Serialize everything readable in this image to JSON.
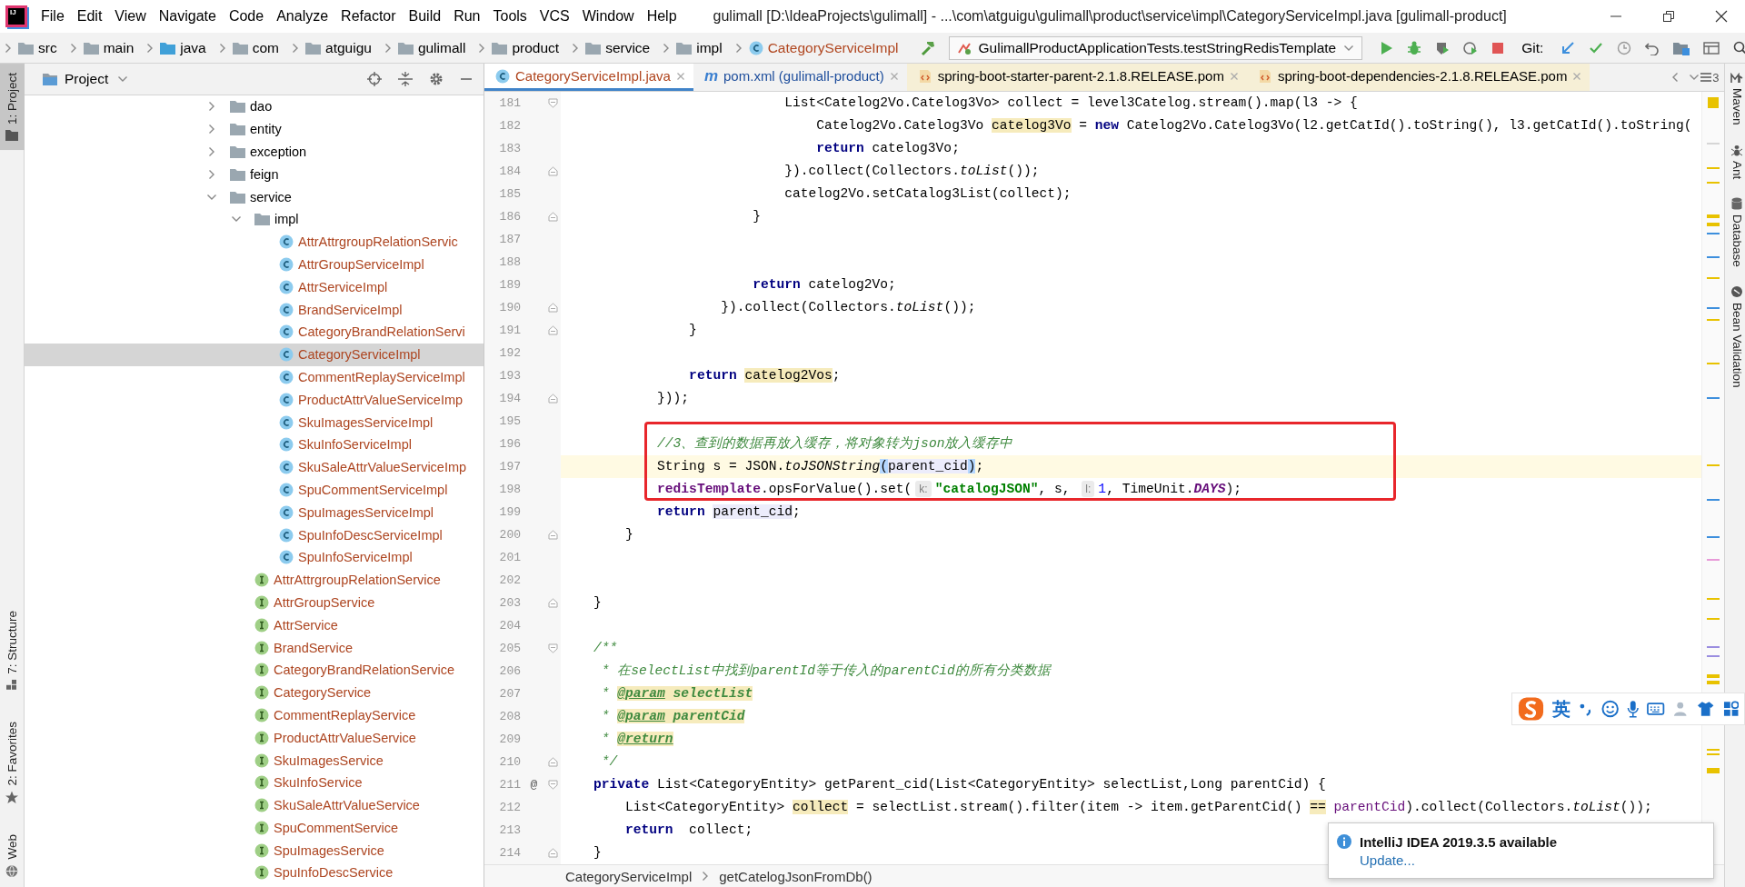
{
  "title_bar": {
    "logo_text": "IJ",
    "menus": [
      "File",
      "Edit",
      "View",
      "Navigate",
      "Code",
      "Analyze",
      "Refactor",
      "Build",
      "Run",
      "Tools",
      "VCS",
      "Window",
      "Help"
    ],
    "title": "gulimall [D:\\IdeaProjects\\gulimall] - ...\\com\\atguigu\\gulimall\\product\\service\\impl\\CategoryServiceImpl.java [gulimall-product]"
  },
  "navigation_bar": {
    "breadcrumbs": [
      {
        "label": "src",
        "kind": "folder"
      },
      {
        "label": "main",
        "kind": "folder"
      },
      {
        "label": "java",
        "kind": "source"
      },
      {
        "label": "com",
        "kind": "folder"
      },
      {
        "label": "atguigu",
        "kind": "folder"
      },
      {
        "label": "gulimall",
        "kind": "folder"
      },
      {
        "label": "product",
        "kind": "folder"
      },
      {
        "label": "service",
        "kind": "folder"
      },
      {
        "label": "impl",
        "kind": "folder"
      },
      {
        "label": "CategoryServiceImpl",
        "kind": "class"
      }
    ],
    "run_configuration": "GulimallProductApplicationTests.testStringRedisTemplate",
    "vcs_label": "Git:"
  },
  "left_tool_strip": [
    {
      "label": "1: Project",
      "kind": "project",
      "selected": true
    },
    {
      "label": "7: Structure",
      "kind": "structure",
      "selected": false
    },
    {
      "label": "2: Favorites",
      "kind": "favorites",
      "selected": false
    },
    {
      "label": "Web",
      "kind": "web",
      "selected": false
    }
  ],
  "project_panel": {
    "title": "Project",
    "tree": [
      {
        "label": "dao",
        "kind": "folder",
        "expanded": false,
        "selected": false
      },
      {
        "label": "entity",
        "kind": "folder",
        "expanded": false,
        "selected": false
      },
      {
        "label": "exception",
        "kind": "folder",
        "expanded": false,
        "selected": false
      },
      {
        "label": "feign",
        "kind": "folder",
        "expanded": false,
        "selected": false
      },
      {
        "label": "service",
        "kind": "folder",
        "expanded": true,
        "selected": false,
        "children": [
          {
            "label": "impl",
            "kind": "folder",
            "expanded": true,
            "selected": false,
            "children": [
              {
                "label": "AttrAttrgroupRelationServic",
                "kind": "class",
                "selected": false
              },
              {
                "label": "AttrGroupServiceImpl",
                "kind": "class",
                "selected": false
              },
              {
                "label": "AttrServiceImpl",
                "kind": "class",
                "selected": false
              },
              {
                "label": "BrandServiceImpl",
                "kind": "class",
                "selected": false
              },
              {
                "label": "CategoryBrandRelationServi",
                "kind": "class",
                "selected": false
              },
              {
                "label": "CategoryServiceImpl",
                "kind": "class",
                "selected": true
              },
              {
                "label": "CommentReplayServiceImpl",
                "kind": "class",
                "selected": false
              },
              {
                "label": "ProductAttrValueServiceImp",
                "kind": "class",
                "selected": false
              },
              {
                "label": "SkuImagesServiceImpl",
                "kind": "class",
                "selected": false
              },
              {
                "label": "SkuInfoServiceImpl",
                "kind": "class",
                "selected": false
              },
              {
                "label": "SkuSaleAttrValueServiceImp",
                "kind": "class",
                "selected": false
              },
              {
                "label": "SpuCommentServiceImpl",
                "kind": "class",
                "selected": false
              },
              {
                "label": "SpuImagesServiceImpl",
                "kind": "class",
                "selected": false
              },
              {
                "label": "SpuInfoDescServiceImpl",
                "kind": "class",
                "selected": false
              },
              {
                "label": "SpuInfoServiceImpl",
                "kind": "class",
                "selected": false
              }
            ]
          },
          {
            "label": "AttrAttrgroupRelationService",
            "kind": "interface",
            "selected": false
          },
          {
            "label": "AttrGroupService",
            "kind": "interface",
            "selected": false
          },
          {
            "label": "AttrService",
            "kind": "interface",
            "selected": false
          },
          {
            "label": "BrandService",
            "kind": "interface",
            "selected": false
          },
          {
            "label": "CategoryBrandRelationService",
            "kind": "interface",
            "selected": false
          },
          {
            "label": "CategoryService",
            "kind": "interface",
            "selected": false
          },
          {
            "label": "CommentReplayService",
            "kind": "interface",
            "selected": false
          },
          {
            "label": "ProductAttrValueService",
            "kind": "interface",
            "selected": false
          },
          {
            "label": "SkuImagesService",
            "kind": "interface",
            "selected": false
          },
          {
            "label": "SkuInfoService",
            "kind": "interface",
            "selected": false
          },
          {
            "label": "SkuSaleAttrValueService",
            "kind": "interface",
            "selected": false
          },
          {
            "label": "SpuCommentService",
            "kind": "interface",
            "selected": false
          },
          {
            "label": "SpuImagesService",
            "kind": "interface",
            "selected": false
          },
          {
            "label": "SpuInfoDescService",
            "kind": "interface",
            "selected": false
          }
        ]
      }
    ]
  },
  "editor": {
    "tabs": [
      {
        "label": "CategoryServiceImpl.java",
        "kind": "class",
        "selected": true,
        "non_project": false
      },
      {
        "label": "pom.xml (gulimall-product)",
        "kind": "maven",
        "icon_text": "m",
        "selected": false,
        "non_project": false
      },
      {
        "label": "spring-boot-starter-parent-2.1.8.RELEASE.pom",
        "kind": "xml",
        "selected": false,
        "non_project": true
      },
      {
        "label": "spring-boot-dependencies-2.1.8.RELEASE.pom",
        "kind": "xml",
        "selected": false,
        "non_project": true
      }
    ],
    "hidden_tab_count": "3",
    "lines": [
      {
        "number": "181",
        "current": false,
        "fold_start": true,
        "tokens": [
          {
            "kind": "plain",
            "text": "                            List<Catelog2Vo.Catelog3Vo> collect = level3Catelog.stream().map(l3 -> {"
          }
        ]
      },
      {
        "number": "182",
        "current": false,
        "tokens": [
          {
            "kind": "plain",
            "text": "                                Catelog2Vo.Catelog3Vo "
          },
          {
            "kind": "usage",
            "text": "catelog3Vo"
          },
          {
            "kind": "plain",
            "text": " = "
          },
          {
            "kind": "keyword",
            "text": "new"
          },
          {
            "kind": "plain",
            "text": " Catelog2Vo.Catelog3Vo(l2.getCatId().toString(), l3.getCatId().toString("
          }
        ]
      },
      {
        "number": "183",
        "current": false,
        "tokens": [
          {
            "kind": "keyword",
            "text": "                                return"
          },
          {
            "kind": "plain",
            "text": " catelog3Vo;"
          }
        ]
      },
      {
        "number": "184",
        "current": false,
        "fold_end": true,
        "tokens": [
          {
            "kind": "plain",
            "text": "                            }).collect(Collectors."
          },
          {
            "kind": "static",
            "text": "toList"
          },
          {
            "kind": "plain",
            "text": "());"
          }
        ]
      },
      {
        "number": "185",
        "current": false,
        "tokens": [
          {
            "kind": "plain",
            "text": "                            catelog2Vo.setCatalog3List(collect);"
          }
        ]
      },
      {
        "number": "186",
        "current": false,
        "fold_end": true,
        "tokens": [
          {
            "kind": "plain",
            "text": "                        }"
          }
        ]
      },
      {
        "number": "187",
        "current": false
      },
      {
        "number": "188",
        "current": false
      },
      {
        "number": "189",
        "current": false,
        "tokens": [
          {
            "kind": "keyword",
            "text": "                        return"
          },
          {
            "kind": "plain",
            "text": " catelog2Vo;"
          }
        ]
      },
      {
        "number": "190",
        "current": false,
        "fold_end": true,
        "tokens": [
          {
            "kind": "plain",
            "text": "                    }).collect(Collectors."
          },
          {
            "kind": "static",
            "text": "toList"
          },
          {
            "kind": "plain",
            "text": "());"
          }
        ]
      },
      {
        "number": "191",
        "current": false,
        "fold_end": true,
        "tokens": [
          {
            "kind": "plain",
            "text": "                }"
          }
        ]
      },
      {
        "number": "192",
        "current": false
      },
      {
        "number": "193",
        "current": false,
        "tokens": [
          {
            "kind": "keyword",
            "text": "                return "
          },
          {
            "kind": "usage",
            "text": "catelog2Vos"
          },
          {
            "kind": "plain",
            "text": ";"
          }
        ]
      },
      {
        "number": "194",
        "current": false,
        "fold_end": true,
        "tokens": [
          {
            "kind": "plain",
            "text": "            }));"
          }
        ]
      },
      {
        "number": "195",
        "current": false
      },
      {
        "number": "196",
        "current": false,
        "framed": true,
        "tokens": [
          {
            "kind": "comment",
            "text": "            //3、查到的数据再放入缓存，将对象转为json放入缓存中"
          }
        ]
      },
      {
        "number": "197",
        "current": true,
        "framed": true,
        "tokens": [
          {
            "kind": "plain",
            "text": "            String s = JSON."
          },
          {
            "kind": "static",
            "text": "toJSONString"
          },
          {
            "kind": "brace",
            "text": "("
          },
          {
            "kind": "read",
            "text": "parent_cid"
          },
          {
            "kind": "brace",
            "text": ")"
          },
          {
            "kind": "plain",
            "text": ";"
          }
        ]
      },
      {
        "number": "198",
        "current": false,
        "framed": true,
        "tokens": [
          {
            "kind": "field",
            "text": "            redisTemplate"
          },
          {
            "kind": "plain",
            "text": ".opsForValue().set("
          },
          {
            "kind": "hint",
            "text": "k:"
          },
          {
            "kind": "string",
            "text": "\"catalogJSON\""
          },
          {
            "kind": "plain",
            "text": ", s, "
          },
          {
            "kind": "hint",
            "text": "l:"
          },
          {
            "kind": "number",
            "text": "1"
          },
          {
            "kind": "plain",
            "text": ", TimeUnit."
          },
          {
            "kind": "constant",
            "text": "DAYS"
          },
          {
            "kind": "plain",
            "text": ");"
          }
        ]
      },
      {
        "number": "199",
        "current": false,
        "tokens": [
          {
            "kind": "keyword",
            "text": "            return "
          },
          {
            "kind": "read",
            "text": "parent_cid"
          },
          {
            "kind": "plain",
            "text": ";"
          }
        ]
      },
      {
        "number": "200",
        "current": false,
        "fold_end": true,
        "tokens": [
          {
            "kind": "plain",
            "text": "        }"
          }
        ]
      },
      {
        "number": "201",
        "current": false
      },
      {
        "number": "202",
        "current": false
      },
      {
        "number": "203",
        "current": false,
        "fold_end": true,
        "tokens": [
          {
            "kind": "plain",
            "text": "    }"
          }
        ]
      },
      {
        "number": "204",
        "current": false
      },
      {
        "number": "205",
        "current": false,
        "fold_start": true,
        "tokens": [
          {
            "kind": "comment",
            "text": "    /**"
          }
        ]
      },
      {
        "number": "206",
        "current": false,
        "tokens": [
          {
            "kind": "comment",
            "text": "     * 在selectList中找到parentId等于传入的parentCid的所有分类数据"
          }
        ]
      },
      {
        "number": "207",
        "current": false,
        "tokens": [
          {
            "kind": "comment",
            "text": "     * "
          },
          {
            "kind": "doctag",
            "text": "@param"
          },
          {
            "kind": "docref",
            "text": " selectList"
          }
        ]
      },
      {
        "number": "208",
        "current": false,
        "tokens": [
          {
            "kind": "comment",
            "text": "     * "
          },
          {
            "kind": "doctag",
            "text": "@param"
          },
          {
            "kind": "docref",
            "text": " parentCid"
          }
        ]
      },
      {
        "number": "209",
        "current": false,
        "tokens": [
          {
            "kind": "comment",
            "text": "     * "
          },
          {
            "kind": "doctag",
            "text": "@return"
          }
        ]
      },
      {
        "number": "210",
        "current": false,
        "fold_end": true,
        "tokens": [
          {
            "kind": "comment",
            "text": "     */"
          }
        ]
      },
      {
        "number": "211",
        "current": false,
        "fold_start": true,
        "gutter_text": "@",
        "tokens": [
          {
            "kind": "keyword",
            "text": "    private"
          },
          {
            "kind": "plain",
            "text": " List<CategoryEntity> getParent_cid(List<CategoryEntity> selectList,Long parentCid) {"
          }
        ]
      },
      {
        "number": "212",
        "current": false,
        "tokens": [
          {
            "kind": "plain",
            "text": "        List<CategoryEntity> "
          },
          {
            "kind": "usage",
            "text": "collect"
          },
          {
            "kind": "plain",
            "text": " = selectList.stream().filter(item -> item.getParentCid() "
          },
          {
            "kind": "usage",
            "text": "=="
          },
          {
            "kind": "variable",
            "text": " parentCid"
          },
          {
            "kind": "plain",
            "text": ").collect(Collectors."
          },
          {
            "kind": "static",
            "text": "toList"
          },
          {
            "kind": "plain",
            "text": "());"
          }
        ]
      },
      {
        "number": "213",
        "current": false,
        "tokens": [
          {
            "kind": "keyword",
            "text": "        return"
          },
          {
            "kind": "plain",
            "text": "  collect;"
          }
        ]
      },
      {
        "number": "214",
        "current": false,
        "fold_end": true,
        "tokens": [
          {
            "kind": "plain",
            "text": "    }"
          }
        ]
      }
    ],
    "breadcrumbs": [
      "CategoryServiceImpl",
      "getCatelogJsonFromDb()"
    ]
  },
  "right_tool_strip": [
    {
      "label": "Maven",
      "kind": "maven"
    },
    {
      "label": "Ant",
      "kind": "ant"
    },
    {
      "label": "Database",
      "kind": "database"
    },
    {
      "label": "Bean Validation",
      "kind": "bean"
    }
  ],
  "notification": {
    "title": "IntelliJ IDEA 2019.3.5 available",
    "link": "Update..."
  },
  "ime_toolbar": {
    "mode": "英"
  }
}
